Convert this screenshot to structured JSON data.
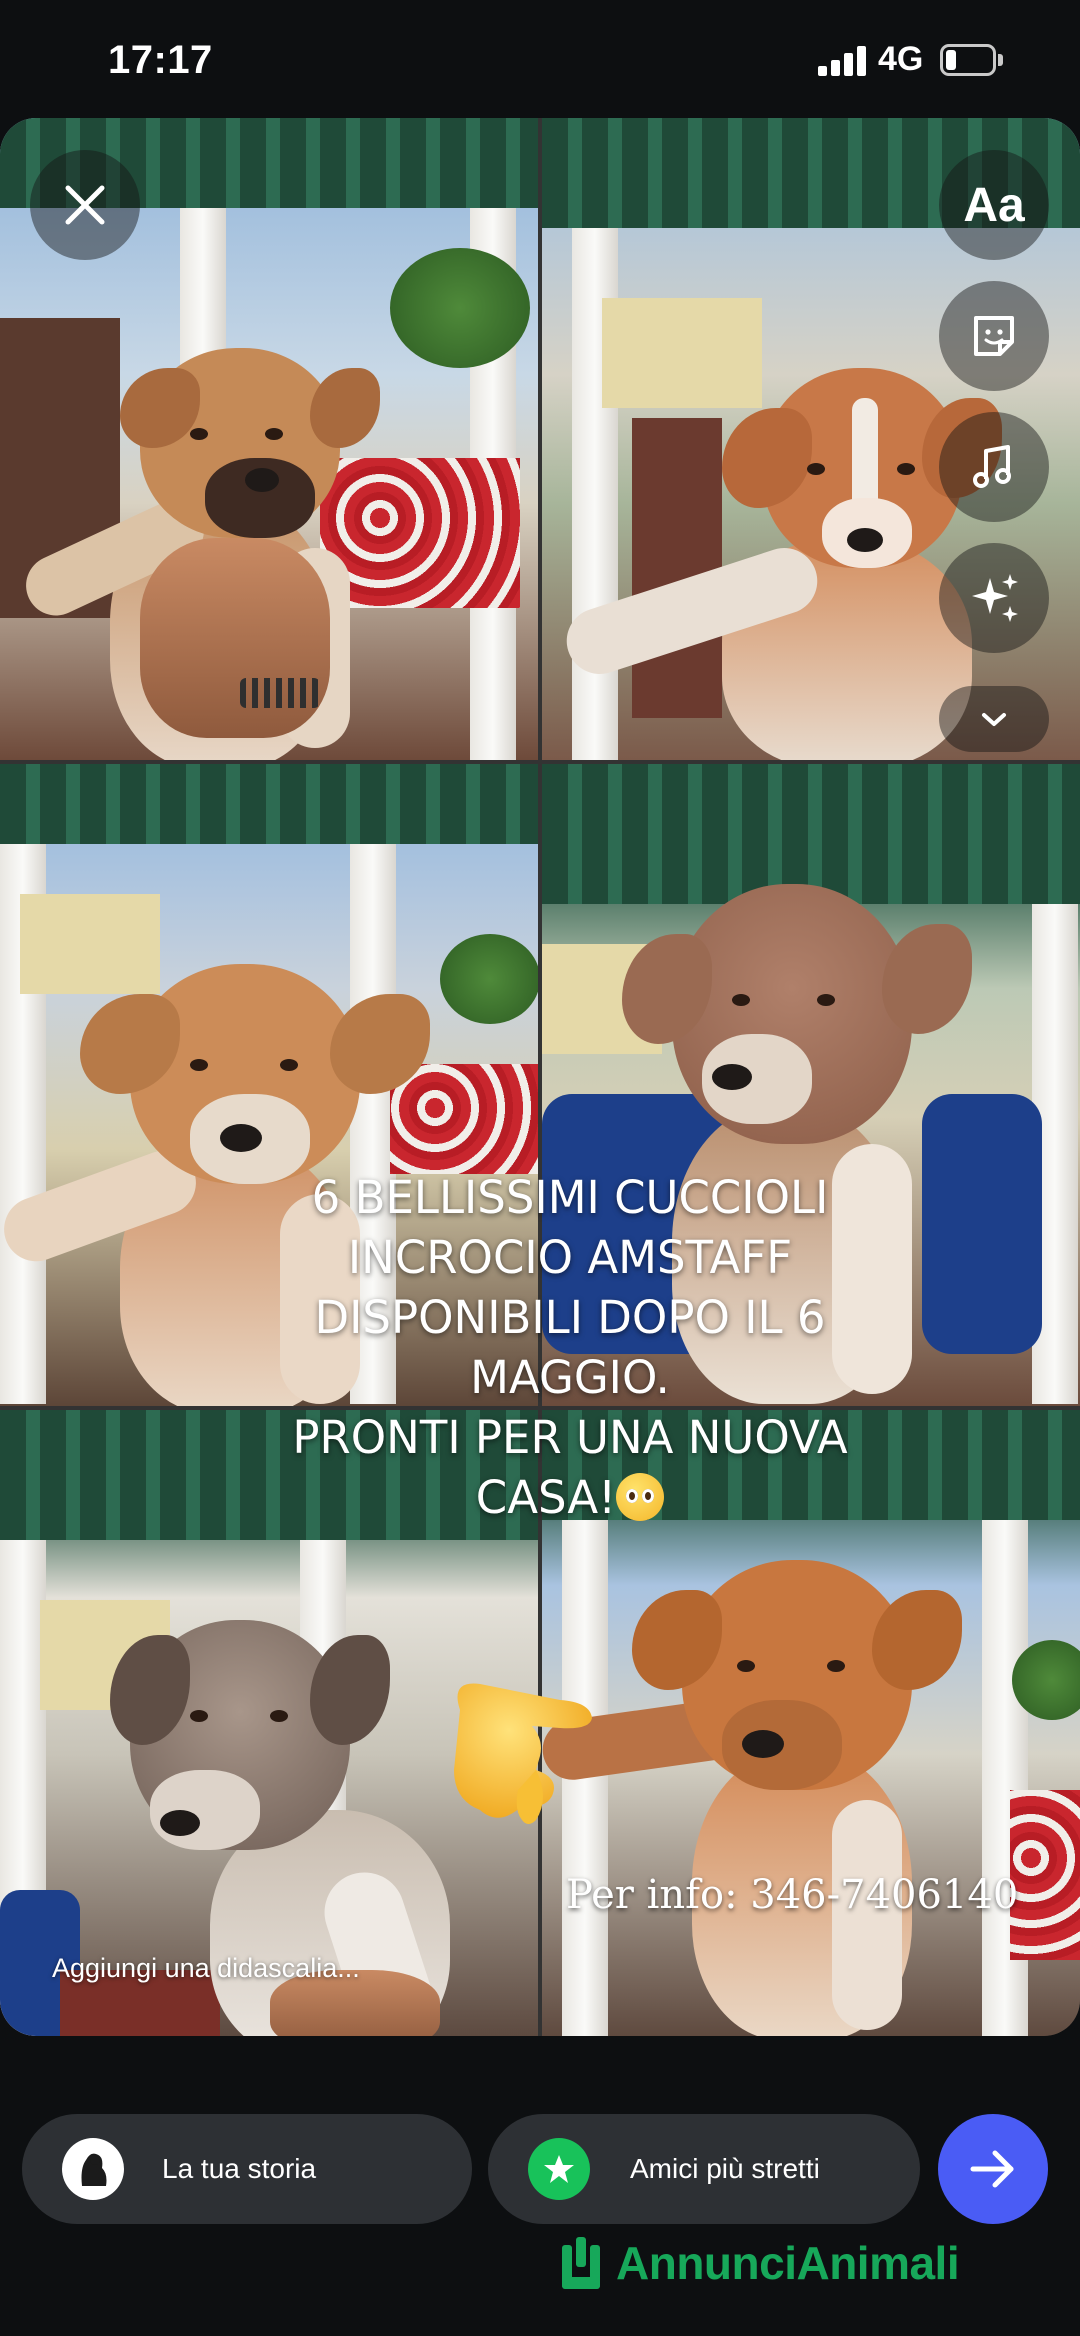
{
  "status_bar": {
    "time": "17:17",
    "network": "4G"
  },
  "story": {
    "overlay_lines": "6  BELLISSIMI CUCCIOLI\nINCROCIO AMSTAFF\nDISPONIBILI DOPO IL 6\nMAGGIO.\nPRONTI PER UNA NUOVA\nCASA!",
    "info_text": "Per info: 346-7406140",
    "caption_placeholder": "Aggiungi una didascalia..."
  },
  "toolbar": {
    "text_tool_label": "Aa"
  },
  "icons": {
    "close": "close-icon",
    "text": "text-tool-icon",
    "sticker": "sticker-icon",
    "music": "music-icon",
    "effects": "sparkles-icon",
    "more": "chevron-down-icon",
    "send": "arrow-right-icon",
    "close_friends": "star-icon"
  },
  "share": {
    "your_story_label": "La tua storia",
    "close_friends_label": "Amici più stretti"
  },
  "watermark": {
    "text": "AnnunciAnimali"
  },
  "colors": {
    "send_button": "#4a5cf5",
    "close_friends_badge": "#18c25a",
    "watermark": "#17a85a"
  }
}
